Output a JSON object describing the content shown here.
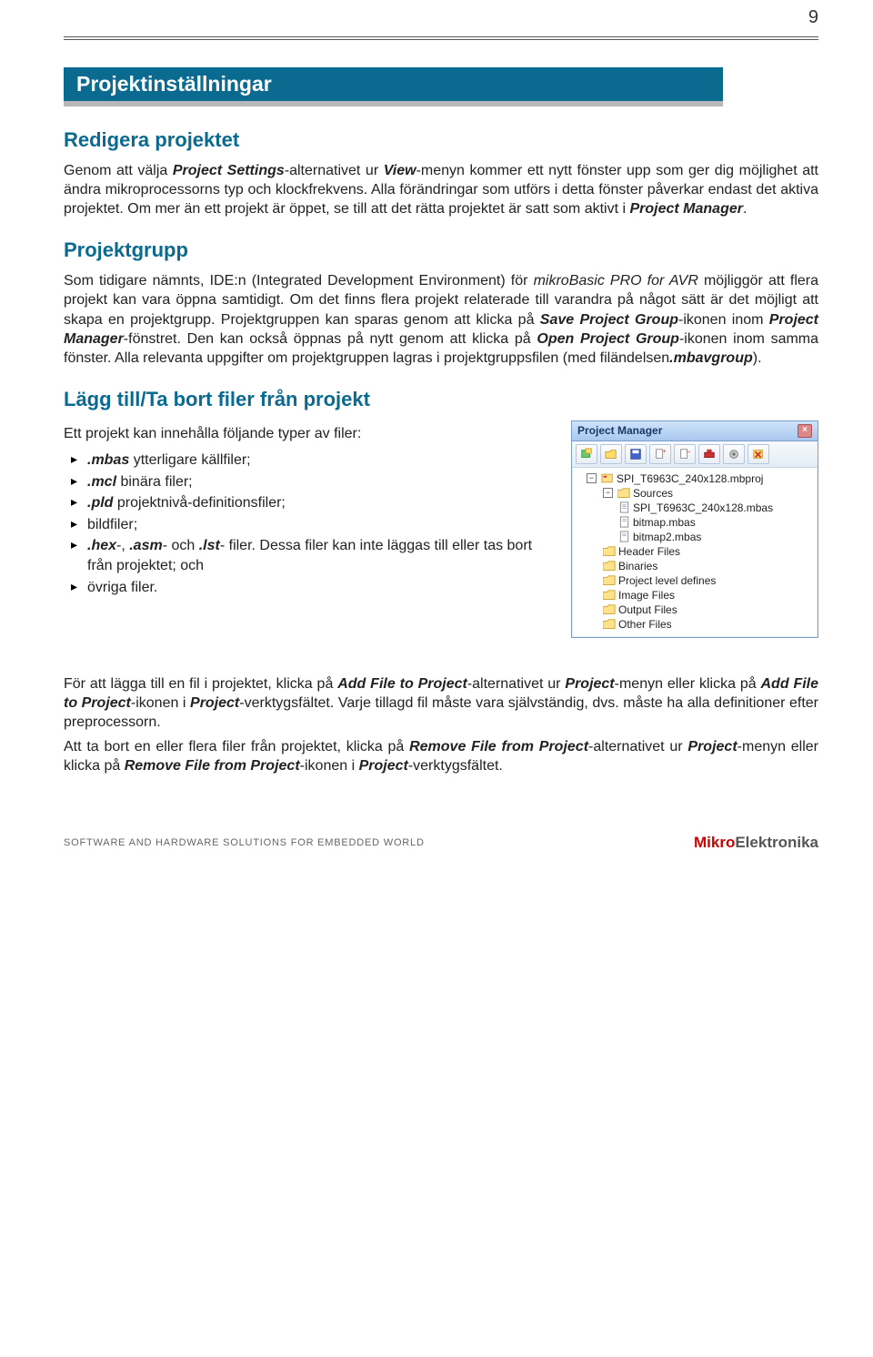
{
  "pagenum": "9",
  "title": "Projektinställningar",
  "s1": {
    "heading": "Redigera projektet",
    "p_pre1": "Genom att välja ",
    "p_bi1": "Project Settings",
    "p_mid1": "-alternativet ur ",
    "p_bi2": "View",
    "p_post1": "-menyn kommer ett nytt fönster upp som ger dig möjlighet att ändra mikroprocessorns typ och klockfrekvens. Alla förändringar som utförs i detta fönster påverkar endast det aktiva projektet. Om mer än ett projekt är öppet, se till att det rätta projektet är satt som aktivt i ",
    "p_bi3": "Project Manager",
    "p_end1": "."
  },
  "s2": {
    "heading": "Projektgrupp",
    "p_pre": "Som tidigare nämnts, IDE:n (Integrated Development Environment) för ",
    "p_it1": "mikroBasic PRO for AVR",
    "p_mid1": " möjliggör att flera projekt kan vara öppna samtidigt. Om det finns flera projekt relaterade till varandra på något sätt är det möjligt att skapa en projektgrupp. Projektgruppen kan sparas genom att klicka på ",
    "p_bi1": "Save Project Group",
    "p_mid2": "-ikonen inom ",
    "p_bi2": "Project Manager",
    "p_mid3": "-fönstret. Den kan också öppnas på nytt genom att klicka på ",
    "p_bi3": "Open Project Group",
    "p_mid4": "-ikonen inom samma fönster. Alla relevanta uppgifter om projektgruppen lagras i projektgruppsfilen (med filändelsen",
    "p_bi4": ".mbavgroup",
    "p_end": ")."
  },
  "s3": {
    "heading": "Lägg till/Ta bort filer från projekt",
    "intro": "Ett projekt kan innehålla följande typer av filer:",
    "items": [
      {
        "bi": ".mbas",
        "rest": " ytterligare källfiler;"
      },
      {
        "bi": ".mcl",
        "rest": " binära filer;"
      },
      {
        "bi": ".pld",
        "rest": " projektnivå-definitionsfiler;"
      },
      {
        "plain": "bildfiler;"
      },
      {
        "bi1": ".hex",
        "mid1": "-, ",
        "bi2": ".asm",
        "mid2": "- och ",
        "bi3": ".lst",
        "rest": "- filer. Dessa filer kan inte läggas till eller tas bort från projektet; och"
      },
      {
        "plain": "övriga filer."
      }
    ]
  },
  "s4": {
    "p1_pre": "För att lägga till en fil i projektet, klicka på ",
    "p1_bi1": "Add File to Project",
    "p1_mid1": "-alternativet ur ",
    "p1_bi2": "Project",
    "p1_mid2": "-menyn eller klicka på ",
    "p1_bi3": "Add File to Project",
    "p1_mid3": "-ikonen i ",
    "p1_bi4": "Project",
    "p1_end": "-verktygsfältet. Varje tillagd fil måste vara självständig, dvs. måste ha alla definitioner efter preprocessorn.",
    "p2_pre": "Att ta bort en eller flera filer från projektet, klicka på ",
    "p2_bi1": "Remove File from Project",
    "p2_mid1": "-alternativet ur ",
    "p2_bi2": "Project",
    "p2_mid2": "-menyn eller klicka på ",
    "p2_bi3": "Remove File from Project",
    "p2_mid3": "-ikonen i ",
    "p2_bi4": "Project",
    "p2_end": "-verktygsfältet."
  },
  "pm": {
    "title": "Project Manager",
    "close": "×",
    "root": "SPI_T6963C_240x128.mbproj",
    "sources": "Sources",
    "src_files": [
      "SPI_T6963C_240x128.mbas",
      "bitmap.mbas",
      "bitmap2.mbas"
    ],
    "folders": [
      "Header Files",
      "Binaries",
      "Project level defines",
      "Image Files",
      "Output Files",
      "Other Files"
    ]
  },
  "footer": {
    "left": "SOFTWARE AND HARDWARE SOLUTIONS FOR EMBEDDED WORLD",
    "brand1": "Mikro",
    "brand2": "Elektronika"
  }
}
